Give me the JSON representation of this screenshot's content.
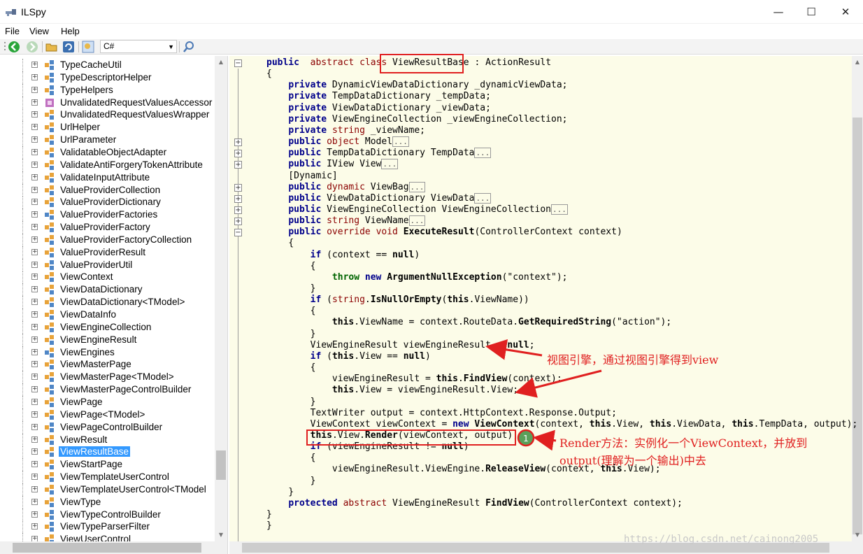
{
  "window": {
    "title": "ILSpy",
    "minimize": "—",
    "maximize": "☐",
    "close": "✕"
  },
  "menu": [
    "File",
    "View",
    "Help"
  ],
  "toolbar": {
    "language": "C#",
    "icons": [
      "back-icon",
      "forward-icon",
      "open-icon",
      "refresh-icon",
      "search-node-icon",
      "search-icon"
    ]
  },
  "tree": {
    "items": [
      {
        "label": "TypeCacheUtil",
        "icon": "class"
      },
      {
        "label": "TypeDescriptorHelper",
        "icon": "class"
      },
      {
        "label": "TypeHelpers",
        "icon": "class"
      },
      {
        "label": "UnvalidatedRequestValuesAccessor",
        "icon": "delegate"
      },
      {
        "label": "UnvalidatedRequestValuesWrapper",
        "icon": "class-public"
      },
      {
        "label": "UrlHelper",
        "icon": "class-public"
      },
      {
        "label": "UrlParameter",
        "icon": "class-public"
      },
      {
        "label": "ValidatableObjectAdapter",
        "icon": "class-public"
      },
      {
        "label": "ValidateAntiForgeryTokenAttribute",
        "icon": "class-public"
      },
      {
        "label": "ValidateInputAttribute",
        "icon": "class-public"
      },
      {
        "label": "ValueProviderCollection",
        "icon": "class-public"
      },
      {
        "label": "ValueProviderDictionary",
        "icon": "class-public"
      },
      {
        "label": "ValueProviderFactories",
        "icon": "class-static"
      },
      {
        "label": "ValueProviderFactory",
        "icon": "class-public"
      },
      {
        "label": "ValueProviderFactoryCollection",
        "icon": "class-public"
      },
      {
        "label": "ValueProviderResult",
        "icon": "class-public"
      },
      {
        "label": "ValueProviderUtil",
        "icon": "class"
      },
      {
        "label": "ViewContext",
        "icon": "class-public"
      },
      {
        "label": "ViewDataDictionary",
        "icon": "class-public"
      },
      {
        "label": "ViewDataDictionary<TModel>",
        "icon": "class-public"
      },
      {
        "label": "ViewDataInfo",
        "icon": "class-public"
      },
      {
        "label": "ViewEngineCollection",
        "icon": "class-public"
      },
      {
        "label": "ViewEngineResult",
        "icon": "class-public"
      },
      {
        "label": "ViewEngines",
        "icon": "class-static"
      },
      {
        "label": "ViewMasterPage",
        "icon": "class-public"
      },
      {
        "label": "ViewMasterPage<TModel>",
        "icon": "class-public"
      },
      {
        "label": "ViewMasterPageControlBuilder",
        "icon": "class"
      },
      {
        "label": "ViewPage",
        "icon": "class-public"
      },
      {
        "label": "ViewPage<TModel>",
        "icon": "class-public"
      },
      {
        "label": "ViewPageControlBuilder",
        "icon": "class"
      },
      {
        "label": "ViewResult",
        "icon": "class-public"
      },
      {
        "label": "ViewResultBase",
        "icon": "class-public",
        "selected": true
      },
      {
        "label": "ViewStartPage",
        "icon": "class-public"
      },
      {
        "label": "ViewTemplateUserControl",
        "icon": "class-public"
      },
      {
        "label": "ViewTemplateUserControl<TModel",
        "icon": "class-public"
      },
      {
        "label": "ViewType",
        "icon": "class-public"
      },
      {
        "label": "ViewTypeControlBuilder",
        "icon": "class"
      },
      {
        "label": "ViewTypeParserFilter",
        "icon": "class"
      },
      {
        "label": "ViewUserControl",
        "icon": "class-public"
      }
    ]
  },
  "code": {
    "class_name": "ViewResultBase",
    "lines": [
      {
        "fold": "minus",
        "segs": [
          [
            "kw",
            "public"
          ],
          [
            "",
            "  "
          ],
          [
            "ty",
            "abstract"
          ],
          [
            "",
            " "
          ],
          [
            "ty",
            "class"
          ],
          [
            "",
            " "
          ],
          [
            "",
            "ViewResultBase"
          ],
          [
            "",
            " : ActionResult"
          ]
        ]
      },
      {
        "segs": [
          [
            "",
            "{"
          ]
        ]
      },
      {
        "segs": [
          [
            "",
            "    "
          ],
          [
            "kw",
            "private"
          ],
          [
            "",
            " DynamicViewDataDictionary _dynamicViewData;"
          ]
        ]
      },
      {
        "segs": [
          [
            "",
            "    "
          ],
          [
            "kw",
            "private"
          ],
          [
            "",
            " TempDataDictionary _tempData;"
          ]
        ]
      },
      {
        "segs": [
          [
            "",
            "    "
          ],
          [
            "kw",
            "private"
          ],
          [
            "",
            " ViewDataDictionary _viewData;"
          ]
        ]
      },
      {
        "segs": [
          [
            "",
            "    "
          ],
          [
            "kw",
            "private"
          ],
          [
            "",
            " ViewEngineCollection _viewEngineCollection;"
          ]
        ]
      },
      {
        "segs": [
          [
            "",
            "    "
          ],
          [
            "kw",
            "private"
          ],
          [
            "",
            " "
          ],
          [
            "ty",
            "string"
          ],
          [
            "",
            " _viewName;"
          ]
        ]
      },
      {
        "fold": "plus",
        "segs": [
          [
            "",
            "    "
          ],
          [
            "kw",
            "public"
          ],
          [
            "",
            " "
          ],
          [
            "ty",
            "object"
          ],
          [
            "",
            " Model"
          ],
          [
            "ell",
            "..."
          ]
        ]
      },
      {
        "fold": "plus",
        "segs": [
          [
            "",
            "    "
          ],
          [
            "kw",
            "public"
          ],
          [
            "",
            " TempDataDictionary TempData"
          ],
          [
            "ell",
            "..."
          ]
        ]
      },
      {
        "fold": "plus",
        "segs": [
          [
            "",
            "    "
          ],
          [
            "kw",
            "public"
          ],
          [
            "",
            " IView View"
          ],
          [
            "ell",
            "..."
          ]
        ]
      },
      {
        "segs": [
          [
            "",
            "    [Dynamic]"
          ]
        ]
      },
      {
        "fold": "plus",
        "segs": [
          [
            "",
            "    "
          ],
          [
            "kw",
            "public"
          ],
          [
            "",
            " "
          ],
          [
            "ty",
            "dynamic"
          ],
          [
            "",
            " ViewBag"
          ],
          [
            "ell",
            "..."
          ]
        ]
      },
      {
        "fold": "plus",
        "segs": [
          [
            "",
            "    "
          ],
          [
            "kw",
            "public"
          ],
          [
            "",
            " ViewDataDictionary ViewData"
          ],
          [
            "ell",
            "..."
          ]
        ]
      },
      {
        "fold": "plus",
        "segs": [
          [
            "",
            "    "
          ],
          [
            "kw",
            "public"
          ],
          [
            "",
            " ViewEngineCollection ViewEngineCollection"
          ],
          [
            "ell",
            "..."
          ]
        ]
      },
      {
        "fold": "plus",
        "segs": [
          [
            "",
            "    "
          ],
          [
            "kw",
            "public"
          ],
          [
            "",
            " "
          ],
          [
            "ty",
            "string"
          ],
          [
            "",
            " ViewName"
          ],
          [
            "ell",
            "..."
          ]
        ]
      },
      {
        "fold": "minus",
        "segs": [
          [
            "",
            "    "
          ],
          [
            "kw",
            "public"
          ],
          [
            "",
            " "
          ],
          [
            "ty",
            "override"
          ],
          [
            "",
            " "
          ],
          [
            "ty",
            "void"
          ],
          [
            "",
            " "
          ],
          [
            "b",
            "ExecuteResult"
          ],
          [
            "",
            "(ControllerContext context)"
          ]
        ]
      },
      {
        "segs": [
          [
            "",
            "    {"
          ]
        ]
      },
      {
        "segs": [
          [
            "",
            "        "
          ],
          [
            "kw",
            "if"
          ],
          [
            "",
            " (context == "
          ],
          [
            "b",
            "null"
          ],
          [
            "",
            ")"
          ]
        ]
      },
      {
        "segs": [
          [
            "",
            "        {"
          ]
        ]
      },
      {
        "segs": [
          [
            "",
            "            "
          ],
          [
            "kw2",
            "throw"
          ],
          [
            "",
            " "
          ],
          [
            "kw",
            "new"
          ],
          [
            "",
            " "
          ],
          [
            "b",
            "ArgumentNullException"
          ],
          [
            "",
            "(\"context\");"
          ]
        ]
      },
      {
        "segs": [
          [
            "",
            "        }"
          ]
        ]
      },
      {
        "segs": [
          [
            "",
            "        "
          ],
          [
            "kw",
            "if"
          ],
          [
            "",
            " ("
          ],
          [
            "ty",
            "string"
          ],
          [
            "",
            "."
          ],
          [
            "b",
            "IsNullOrEmpty"
          ],
          [
            "",
            "("
          ],
          [
            "b",
            "this"
          ],
          [
            "",
            ".ViewName))"
          ]
        ]
      },
      {
        "segs": [
          [
            "",
            "        {"
          ]
        ]
      },
      {
        "segs": [
          [
            "",
            "            "
          ],
          [
            "b",
            "this"
          ],
          [
            "",
            ".ViewName = context.RouteData."
          ],
          [
            "b",
            "GetRequiredString"
          ],
          [
            "",
            "(\"action\");"
          ]
        ]
      },
      {
        "segs": [
          [
            "",
            "        }"
          ]
        ]
      },
      {
        "segs": [
          [
            "",
            "        ViewEngineResult viewEngineResult = "
          ],
          [
            "b",
            "null"
          ],
          [
            "",
            ";"
          ]
        ]
      },
      {
        "segs": [
          [
            "",
            "        "
          ],
          [
            "kw",
            "if"
          ],
          [
            "",
            " ("
          ],
          [
            "b",
            "this"
          ],
          [
            "",
            ".View == "
          ],
          [
            "b",
            "null"
          ],
          [
            "",
            ")"
          ]
        ]
      },
      {
        "segs": [
          [
            "",
            "        {"
          ]
        ]
      },
      {
        "segs": [
          [
            "",
            "            viewEngineResult = "
          ],
          [
            "b",
            "this"
          ],
          [
            "",
            "."
          ],
          [
            "b",
            "FindView"
          ],
          [
            "",
            "(context);"
          ]
        ]
      },
      {
        "segs": [
          [
            "",
            "            "
          ],
          [
            "b",
            "this"
          ],
          [
            "",
            ".View = viewEngineResult.View;"
          ]
        ]
      },
      {
        "segs": [
          [
            "",
            "        }"
          ]
        ]
      },
      {
        "segs": [
          [
            "",
            "        TextWriter output = context.HttpContext.Response.Output;"
          ]
        ]
      },
      {
        "segs": [
          [
            "",
            "        ViewContext viewContext = "
          ],
          [
            "kw",
            "new"
          ],
          [
            "",
            " "
          ],
          [
            "b",
            "ViewContext"
          ],
          [
            "",
            "(context, "
          ],
          [
            "b",
            "this"
          ],
          [
            "",
            ".View, "
          ],
          [
            "b",
            "this"
          ],
          [
            "",
            ".ViewData, "
          ],
          [
            "b",
            "this"
          ],
          [
            "",
            ".TempData, output);"
          ]
        ]
      },
      {
        "segs": [
          [
            "",
            "        "
          ],
          [
            "b",
            "this"
          ],
          [
            "",
            ".View."
          ],
          [
            "b",
            "Render"
          ],
          [
            "",
            "(viewContext, output);"
          ]
        ]
      },
      {
        "segs": [
          [
            "",
            "        "
          ],
          [
            "kw",
            "if"
          ],
          [
            "",
            " (viewEngineResult != "
          ],
          [
            "b",
            "null"
          ],
          [
            "",
            ")"
          ]
        ]
      },
      {
        "segs": [
          [
            "",
            "        {"
          ]
        ]
      },
      {
        "segs": [
          [
            "",
            "            viewEngineResult.ViewEngine."
          ],
          [
            "b",
            "ReleaseView"
          ],
          [
            "",
            "(context, "
          ],
          [
            "b",
            "this"
          ],
          [
            "",
            ".View);"
          ]
        ]
      },
      {
        "segs": [
          [
            "",
            "        }"
          ]
        ]
      },
      {
        "segs": [
          [
            "",
            "    }"
          ]
        ]
      },
      {
        "segs": [
          [
            "",
            "    "
          ],
          [
            "kw",
            "protected"
          ],
          [
            "",
            " "
          ],
          [
            "ty",
            "abstract"
          ],
          [
            "",
            " ViewEngineResult "
          ],
          [
            "b",
            "FindView"
          ],
          [
            "",
            "(ControllerContext context);"
          ]
        ]
      },
      {
        "segs": [
          [
            "",
            "}"
          ]
        ]
      },
      {
        "segs": [
          [
            "",
            "}"
          ]
        ]
      }
    ]
  },
  "annotations": {
    "view_engine": "视图引擎，通过视图引擎得到view",
    "render_line1": "Render方法：实例化一个ViewContext，并放到",
    "render_line2": "output(理解为一个输出)中去",
    "marker": "1"
  },
  "watermark": "https://blog.csdn.net/cainong2005",
  "colors": {
    "selection": "#3399ff",
    "code_background": "#fcfce8",
    "annotation": "#e02020",
    "keyword": "#00008b",
    "type_keyword": "#8b0000"
  }
}
